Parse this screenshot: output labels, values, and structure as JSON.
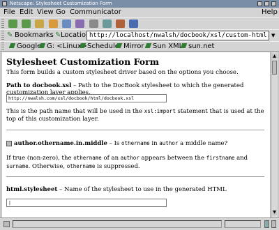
{
  "window": {
    "title": "Netscape: Stylesheet Customization Form"
  },
  "menu": {
    "items": [
      "File",
      "Edit",
      "View",
      "Go",
      "Communicator"
    ],
    "help": "Help"
  },
  "toolbar": {
    "icons": [
      "back-icon",
      "forward-icon",
      "reload-icon",
      "home-icon",
      "search-icon",
      "netscape-icon",
      "print-icon",
      "security-icon",
      "shop-icon",
      "stop-icon"
    ]
  },
  "location": {
    "bookmarks_label": "Bookmarks",
    "location_label": "Location:",
    "url": "http://localhost/nwalsh/docbook/xsl/custom-html.h"
  },
  "links": [
    "Google",
    "G: <Linux>",
    "Schedule",
    "Mirror",
    "Sun XML",
    "sun.net"
  ],
  "page": {
    "heading": "Stylesheet Customization Form",
    "intro": "This form builds a custom stylesheet driver based on the options you choose.",
    "path_name": "Path to docbook.xsl",
    "path_desc": " – Path to the DocBook stylesheet to which the generated customization layer applies.",
    "path_value": "http://nwalsh.com/xsl/docbook/html/docbook.xsl",
    "path_note_a": "This is the path name that will be used in the ",
    "path_note_code": "xsl:import",
    "path_note_b": " statement that is used at the top of this customization layer.",
    "opt_name": "author.othername.in.middle",
    "opt_desc_a": " – Is ",
    "opt_desc_code1": "othername",
    "opt_desc_b": " in ",
    "opt_desc_code2": "author",
    "opt_desc_c": " a middle name?",
    "opt_body_a": "If true (non-zero), the ",
    "opt_body_c1": "othername",
    "opt_body_b": " of an ",
    "opt_body_c2": "author",
    "opt_body_c": " appears between the ",
    "opt_body_c3": "firstname",
    "opt_body_d": " and ",
    "opt_body_c4": "surname",
    "opt_body_e": ". Otherwise, ",
    "opt_body_c5": "othername",
    "opt_body_f": " is suppressed.",
    "css_name": "html.stylesheet",
    "css_desc": " – Name of the stylesheet to use in the generated HTML",
    "css_value": "|"
  }
}
